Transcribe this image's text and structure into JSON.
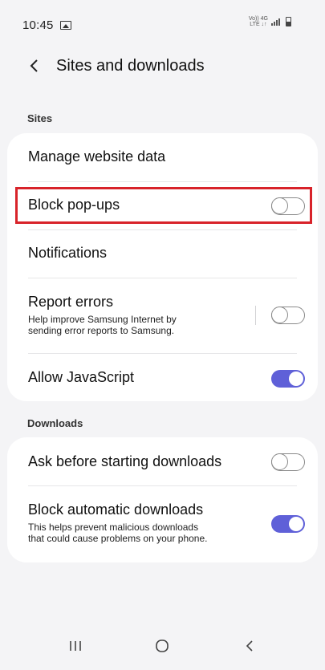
{
  "status_bar": {
    "time": "10:45",
    "network_top": "Vo)) 4G",
    "network_bottom": "LTE ↓↑"
  },
  "header": {
    "title": "Sites and downloads"
  },
  "sites": {
    "section_label": "Sites",
    "items": [
      {
        "title": "Manage website data"
      },
      {
        "title": "Block pop-ups",
        "toggle": false
      },
      {
        "title": "Notifications"
      },
      {
        "title": "Report errors",
        "subtitle_line1": "Help improve Samsung Internet by",
        "subtitle_line2": "sending error reports to Samsung.",
        "toggle": false
      },
      {
        "title": "Allow JavaScript",
        "toggle": true
      }
    ]
  },
  "downloads": {
    "section_label": "Downloads",
    "items": [
      {
        "title": "Ask before starting downloads",
        "toggle": false
      },
      {
        "title": "Block automatic downloads",
        "subtitle_line1": "This helps prevent malicious downloads",
        "subtitle_line2": "that could cause problems on your phone.",
        "toggle": true
      }
    ]
  },
  "colors": {
    "accent": "#5f60d8",
    "highlight": "#d8232a",
    "background": "#f4f4f6"
  },
  "icons": {
    "back": "chevron-left-icon",
    "nav_recents": "recents-icon",
    "nav_home": "home-icon",
    "nav_back": "back-nav-icon"
  }
}
